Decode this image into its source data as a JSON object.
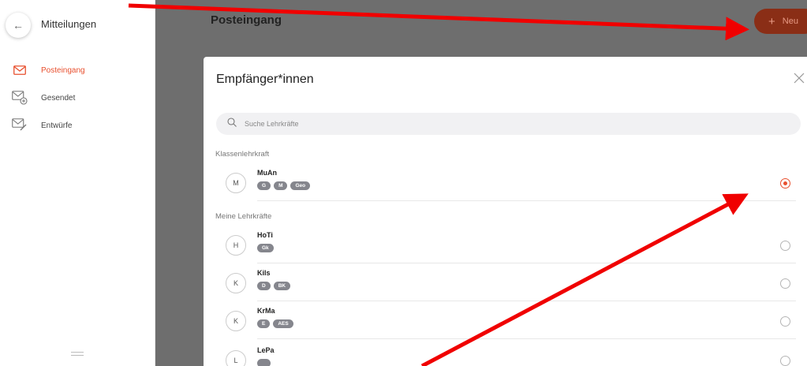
{
  "sidebar": {
    "title": "Mitteilungen",
    "items": [
      {
        "label": "Posteingang",
        "active": true
      },
      {
        "label": "Gesendet",
        "active": false
      },
      {
        "label": "Entwürfe",
        "active": false
      }
    ]
  },
  "header": {
    "title": "Posteingang",
    "new_button_label": "Neu"
  },
  "modal": {
    "title": "Empfänger*innen",
    "search_placeholder": "Suche Lehrkräfte",
    "sections": [
      {
        "label": "Klassenlehrkraft",
        "recipients": [
          {
            "initial": "M",
            "name": "MuAn",
            "tags": [
              "G",
              "M",
              "Geo"
            ],
            "selected": true
          }
        ]
      },
      {
        "label": "Meine Lehrkräfte",
        "recipients": [
          {
            "initial": "H",
            "name": "HoTi",
            "tags": [
              "Gk"
            ],
            "selected": false
          },
          {
            "initial": "K",
            "name": "Kils",
            "tags": [
              "D",
              "BK"
            ],
            "selected": false
          },
          {
            "initial": "K",
            "name": "KrMa",
            "tags": [
              "E",
              "AES"
            ],
            "selected": false
          },
          {
            "initial": "L",
            "name": "LePa",
            "tags": [],
            "selected": false
          }
        ]
      }
    ]
  },
  "colors": {
    "accent": "#e8502f",
    "overlay": "#6e6e6e",
    "annotation_arrow": "#f00000",
    "tag_bg": "#85868d"
  },
  "icons": {
    "back": "arrow-left-icon",
    "inbox": "envelope-icon",
    "sent": "envelope-sent-icon",
    "drafts": "envelope-draft-icon",
    "close": "close-icon",
    "search": "search-icon",
    "add": "plus-icon"
  }
}
